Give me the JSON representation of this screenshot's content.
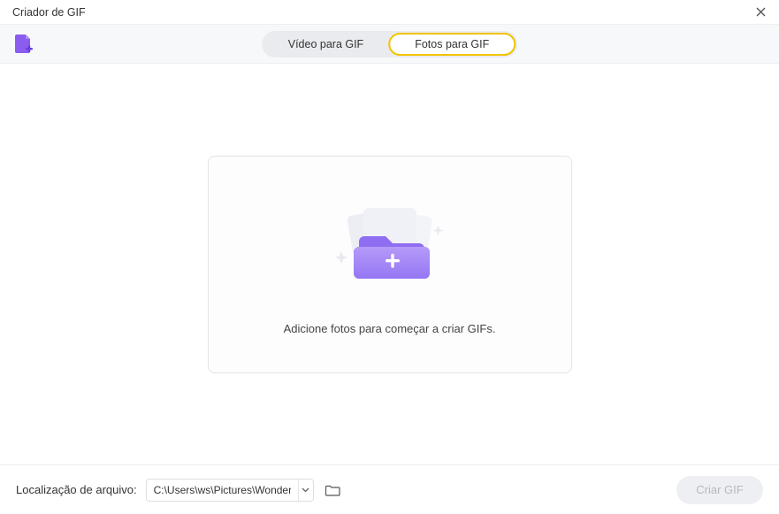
{
  "window": {
    "title": "Criador de GIF"
  },
  "tabs": {
    "video": "Vídeo para GIF",
    "photos": "Fotos para GIF"
  },
  "dropzone": {
    "text": "Adicione fotos para começar a criar GIFs."
  },
  "footer": {
    "location_label": "Localização de arquivo:",
    "path_value": "C:\\Users\\ws\\Pictures\\Wondershare",
    "create_label": "Criar GIF"
  }
}
